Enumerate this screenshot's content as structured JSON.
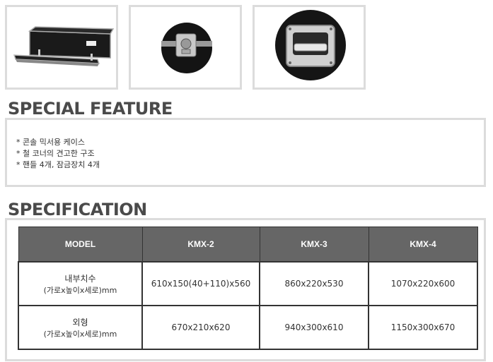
{
  "images": [
    {
      "icon": "flight-case-mixer-photo"
    },
    {
      "icon": "case-latch-photo"
    },
    {
      "icon": "case-handle-photo"
    }
  ],
  "special_feature": {
    "title": "SPECIAL FEATURE",
    "items": [
      "* 콘솔 믹서용 케이스",
      "* 철 코너의 견고한 구조",
      "* 핸들 4개, 잠금장치 4개"
    ]
  },
  "specification": {
    "title": "SPECIFICATION",
    "headers": [
      "MODEL",
      "KMX-2",
      "KMX-3",
      "KMX-4"
    ],
    "rows": [
      {
        "label": "내부치수",
        "sub": "(가로x높이x세로)mm",
        "values": [
          "610x150(40+110)x560",
          "860x220x530",
          "1070x220x600"
        ]
      },
      {
        "label": "외형",
        "sub": "(가로x높이x세로)mm",
        "values": [
          "670x210x620",
          "940x300x610",
          "1150x300x670"
        ]
      }
    ]
  },
  "colors": {
    "header_bg": "#666666",
    "frame": "#dcdcdc",
    "title": "#4a4a4a"
  }
}
